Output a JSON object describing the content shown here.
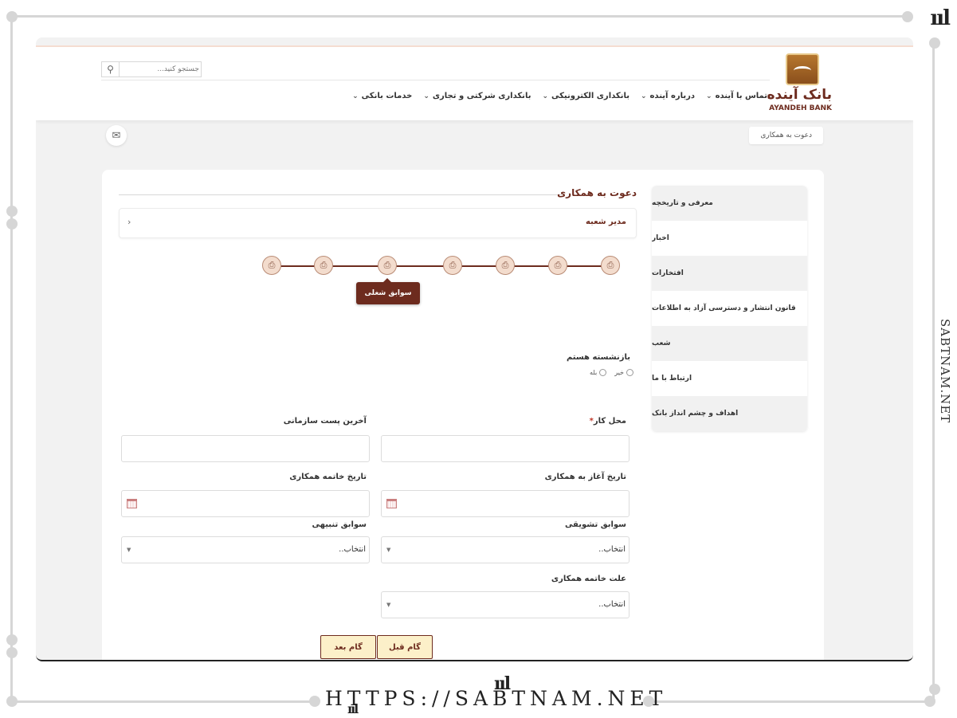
{
  "watermark": {
    "side_text": "SABTNAM.NET",
    "url": "HTTPS://SABTNAM.NET",
    "logo_glyph": "ııl"
  },
  "header": {
    "logo_fa": "بانک آینده",
    "logo_en": "AYANDEH BANK",
    "search_placeholder": "جستجو کنید...",
    "nav": [
      {
        "label": "خدمات بانکی"
      },
      {
        "label": "بانکداری شرکتی و تجاری"
      },
      {
        "label": "بانکداری الکترونیکی"
      },
      {
        "label": "درباره آینده"
      },
      {
        "label": "تماس با آینده"
      }
    ]
  },
  "breadcrumb": "دعوت به همکاری",
  "sidebar": {
    "items": [
      {
        "label": "معرفی و تاریخچه"
      },
      {
        "label": "اخبار"
      },
      {
        "label": "افتخارات"
      },
      {
        "label": "قانون انتشار و دسترسی آزاد به اطلاعات"
      },
      {
        "label": "شعب"
      },
      {
        "label": "ارتباط با ما"
      },
      {
        "label": "اهداف و چشم انداز بانک"
      }
    ]
  },
  "form": {
    "title": "دعوت به همکاری",
    "position": "مدیر شعبه",
    "step_tooltip": "سوابق شغلی",
    "retired_label": "بازنشسته هستم",
    "radio_yes": "بله",
    "radio_no": "خیر",
    "workplace_label": "محل کار",
    "required_mark": "*",
    "last_post_label": "آخرین پست سازمانی",
    "start_date_label": "تاریخ آغاز به همکاری",
    "end_date_label": "تاریخ خاتمه همکاری",
    "incentive_label": "سوابق تشویقی",
    "incentive_value": "انتخاب..",
    "disciplinary_label": "سوابق تنبیهی",
    "disciplinary_value": "انتخاب..",
    "end_reason_label": "علت خاتمه همکاری",
    "end_reason_value": "انتخاب..",
    "prev_button": "گام قبل",
    "next_button": "گام بعد"
  },
  "colors": {
    "brand": "#6d2b1e",
    "button_bg": "#fcf0c9",
    "step_fill": "#f3dccd"
  }
}
